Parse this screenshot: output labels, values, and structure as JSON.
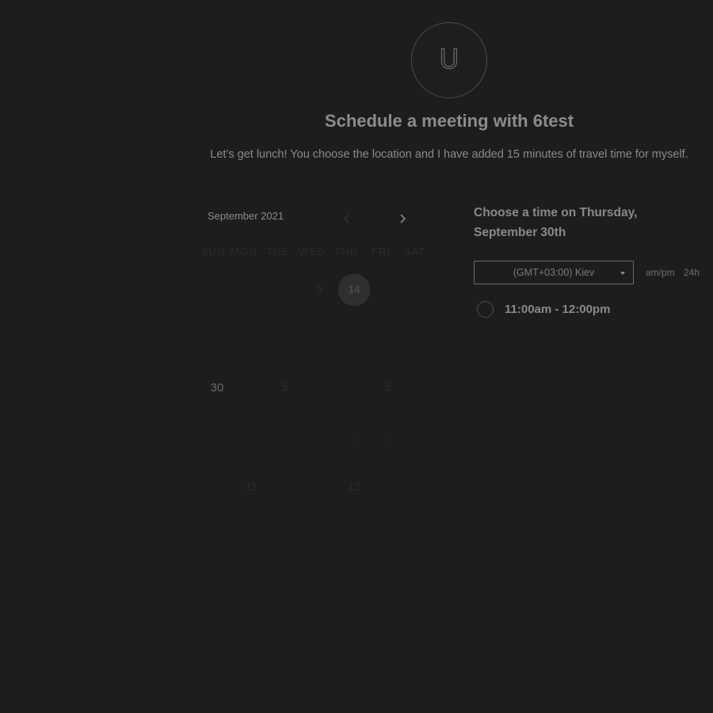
{
  "header": {
    "avatar_letter": "U",
    "title": "Schedule a meeting with 6test",
    "description": "Let’s get lunch! You choose the location and I have added 15 minutes of travel time for myself."
  },
  "calendar": {
    "month": "September 2021",
    "prev_icon": "chevron-left-icon",
    "next_icon": "chevron-right-icon",
    "weekdays": [
      "SUN",
      "MON",
      "TUE",
      "WED",
      "THU",
      "FRI",
      "SAT"
    ],
    "visible_days": {
      "d1": "5",
      "today": "14",
      "d3": "30",
      "d4": "5",
      "d5": "5",
      "d6": "–",
      "d7": "–",
      "d8": "12",
      "d9": "12"
    }
  },
  "time_panel": {
    "heading_line1": "Choose a time on Thursday,",
    "heading_line2": "September 30th",
    "timezone": "(GMT+03:00) Kiev",
    "format_ampm": "am/pm",
    "format_24h": "24h",
    "slots": [
      {
        "label": "11:00am - 12:00pm"
      }
    ]
  },
  "colors": {
    "background": "#1d1d1d",
    "text": "#8a8a8a",
    "muted": "#2c2c2c"
  }
}
